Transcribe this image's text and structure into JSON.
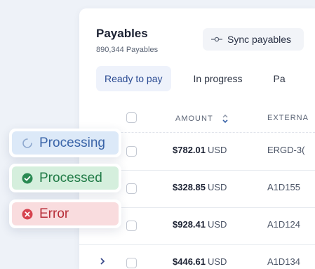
{
  "header": {
    "title": "Payables",
    "subtitle": "890,344 Payables",
    "sync_label": "Sync payables"
  },
  "tabs": [
    {
      "label": "Ready to pay",
      "active": true
    },
    {
      "label": "In progress",
      "active": false
    },
    {
      "label": "Pa",
      "active": false
    }
  ],
  "table": {
    "columns": [
      "AMOUNT",
      "EXTERNA"
    ],
    "rows": [
      {
        "amount": "$782.01",
        "currency": "USD",
        "external": "ERGD-3("
      },
      {
        "amount": "$328.85",
        "currency": "USD",
        "external": "A1D155"
      },
      {
        "amount": "$928.41",
        "currency": "USD",
        "external": "A1D124"
      },
      {
        "amount": "$446.61",
        "currency": "USD",
        "external": "A1D134"
      }
    ]
  },
  "badges": {
    "processing": "Processing",
    "processed": "Processed",
    "error": "Error"
  },
  "colors": {
    "accent": "#3a64a8",
    "success": "#1f7a45",
    "error": "#b72d38"
  },
  "icons": {
    "sync": "sync-dot-icon",
    "sort": "sort-chevrons-icon",
    "expand": "chevron-right-icon",
    "processing": "spinner-icon",
    "processed": "check-circle-icon",
    "error": "x-circle-icon"
  }
}
